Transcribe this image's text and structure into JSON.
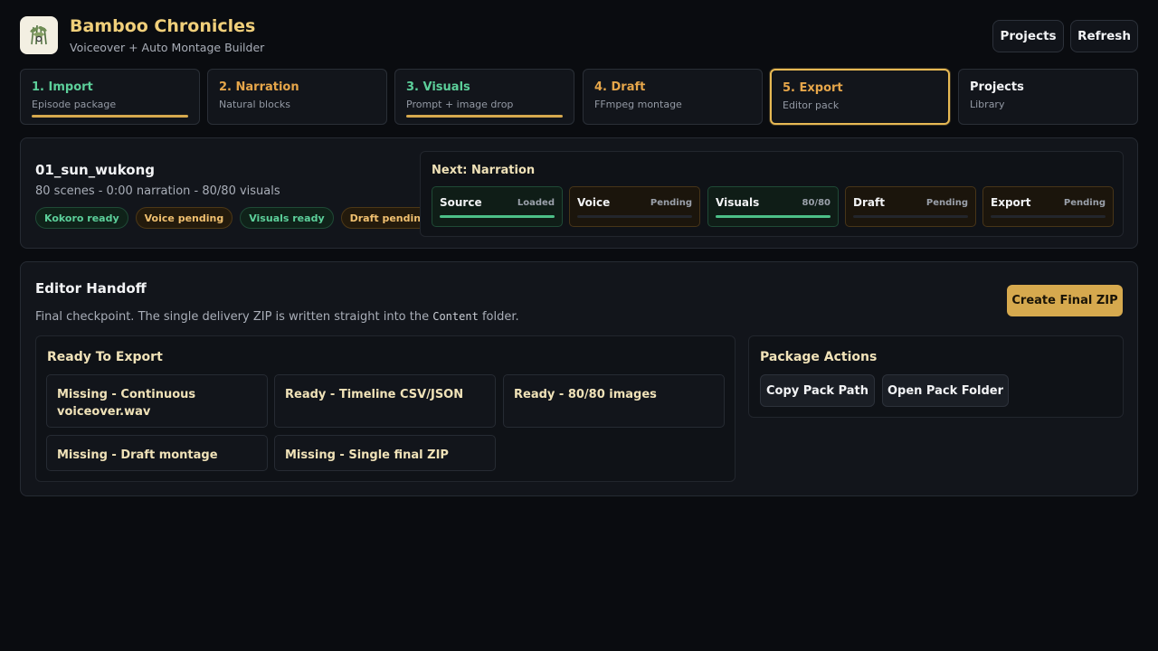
{
  "app": {
    "title": "Bamboo Chronicles",
    "subtitle": "Voiceover + Auto Montage Builder",
    "logo_text": "BAMBOO CHRONICLES"
  },
  "header": {
    "projects_label": "Projects",
    "refresh_label": "Refresh"
  },
  "steps": [
    {
      "title": "1. Import",
      "sub": "Episode package",
      "color": "#5ccf9a",
      "progress": 1
    },
    {
      "title": "2. Narration",
      "sub": "Natural blocks",
      "color": "#e6a64a",
      "progress": 0
    },
    {
      "title": "3. Visuals",
      "sub": "Prompt + image drop",
      "color": "#5ccf9a",
      "progress": 1
    },
    {
      "title": "4. Draft",
      "sub": "FFmpeg montage",
      "color": "#e6a64a",
      "progress": 0
    },
    {
      "title": "5. Export",
      "sub": "Editor pack",
      "color": "#e6a64a",
      "progress": 0,
      "active": true
    },
    {
      "title": "Projects",
      "sub": "Library",
      "color": "#f2f3f5",
      "progress": 0
    }
  ],
  "episode": {
    "name": "01_sun_wukong",
    "meta": "80 scenes - 0:00 narration - 80/80 visuals",
    "chips": [
      {
        "label": "Kokoro ready",
        "state": "ok"
      },
      {
        "label": "Voice pending",
        "state": "warn"
      },
      {
        "label": "Visuals ready",
        "state": "ok"
      },
      {
        "label": "Draft pending",
        "state": "warn"
      }
    ]
  },
  "next": {
    "title": "Next: Narration",
    "stages": [
      {
        "name": "Source",
        "status": "Loaded",
        "progress": 1,
        "state": "done"
      },
      {
        "name": "Voice",
        "status": "Pending",
        "progress": 0,
        "state": "pending"
      },
      {
        "name": "Visuals",
        "status": "80/80",
        "progress": 1,
        "state": "done"
      },
      {
        "name": "Draft",
        "status": "Pending",
        "progress": 0,
        "state": "pending"
      },
      {
        "name": "Export",
        "status": "Pending",
        "progress": 0,
        "state": "pending"
      }
    ]
  },
  "handoff": {
    "title": "Editor Handoff",
    "desc_before": "Final checkpoint. The single delivery ZIP is written straight into the ",
    "desc_code": "Content",
    "desc_after": " folder.",
    "create_zip_label": "Create Final ZIP",
    "ready_title": "Ready To Export",
    "items": [
      "Missing - Continuous voiceover.wav",
      "Ready - Timeline CSV/JSON",
      "Ready - 80/80 images",
      "Missing - Draft montage",
      "Missing - Single final ZIP"
    ],
    "actions_title": "Package Actions",
    "copy_path_label": "Copy Pack Path",
    "open_folder_label": "Open Pack Folder"
  }
}
